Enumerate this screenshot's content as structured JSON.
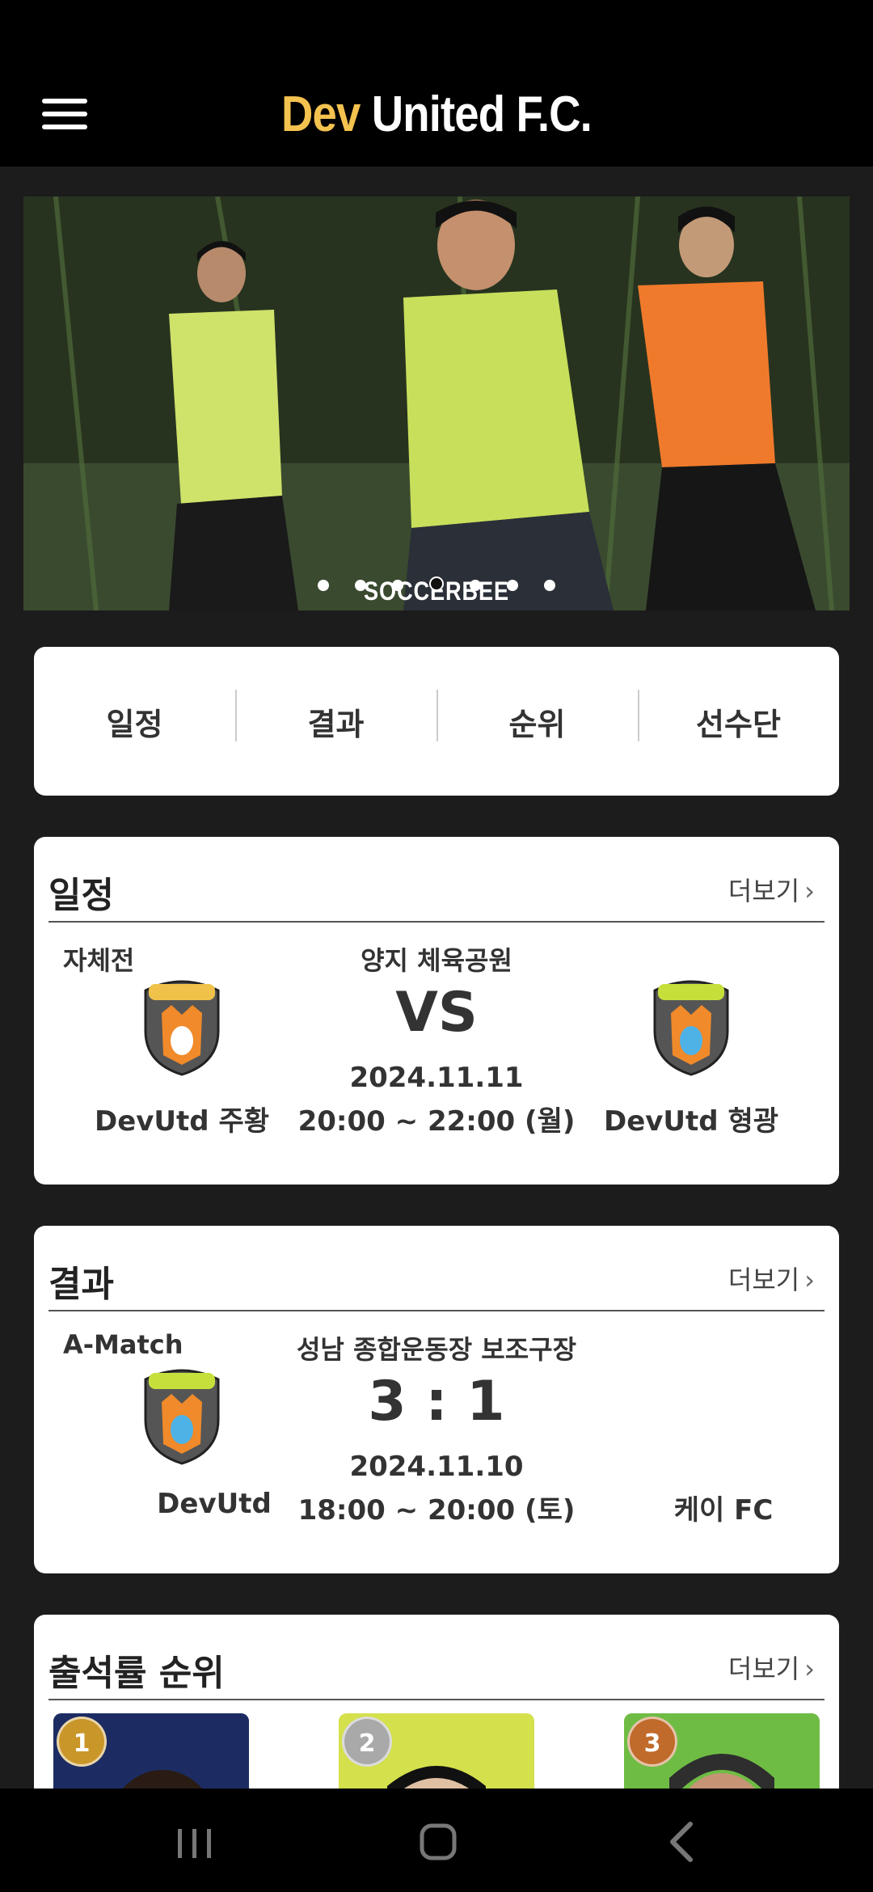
{
  "header": {
    "brand_highlight": "Dev",
    "brand_rest": " United F.C.",
    "menu_icon": "hamburger-menu-icon"
  },
  "banner": {
    "watermark": "SOCCERBEE",
    "dots_count": 7,
    "active_dot_index": 3
  },
  "quick_nav": {
    "items": [
      "일정",
      "결과",
      "순위",
      "선수단"
    ]
  },
  "schedule": {
    "title": "일정",
    "more_label": "더보기",
    "match_type": "자체전",
    "venue": "양지 체육공원",
    "vs_label": "VS",
    "date": "2024.11.11",
    "time": "20:00 ~ 22:00 (월)",
    "home_team": "DevUtd 주황",
    "away_team": "DevUtd 형광"
  },
  "results": {
    "title": "결과",
    "more_label": "더보기",
    "match_type": "A-Match",
    "venue": "성남 종합운동장 보조구장",
    "score": "3 : 1",
    "date": "2024.11.10",
    "time": "18:00 ~ 20:00 (토)",
    "home_team": "DevUtd",
    "away_team": "케이 FC"
  },
  "attendance": {
    "title": "출석률 순위",
    "more_label": "더보기",
    "ranks": [
      "1",
      "2",
      "3"
    ]
  },
  "colors": {
    "brand_accent": "#f4c24f",
    "gold": "#c9962a",
    "silver": "#a9a9a9",
    "bronze": "#c06a2b"
  }
}
